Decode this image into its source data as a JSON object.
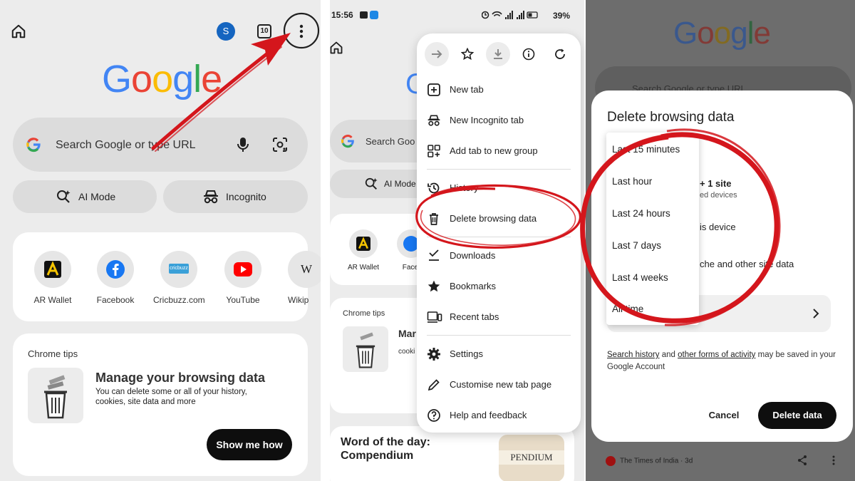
{
  "panel1": {
    "avatar_letter": "S",
    "tab_count": "10",
    "logo": [
      "G",
      "o",
      "o",
      "g",
      "l",
      "e"
    ],
    "search_placeholder": "Search Google or type URL",
    "ai_mode": "AI Mode",
    "incognito": "Incognito",
    "shortcuts": [
      {
        "label": "AR Wallet",
        "color": "#111111"
      },
      {
        "label": "Facebook",
        "color": "#1877f2"
      },
      {
        "label": "Cricbuzz.com",
        "color": "#3aa0d8"
      },
      {
        "label": "YouTube",
        "color": "#ff0000"
      },
      {
        "label": "Wikip"
      }
    ],
    "chrome_tips": "Chrome tips",
    "tip_title": "Manage your browsing data",
    "tip_body": "You can delete some or all of your history, cookies, site data and more",
    "tip_button": "Show me how"
  },
  "panel2": {
    "status_time": "15:56",
    "status_battery": "39%",
    "search_partial": "Search Goo",
    "ai_partial": "AI Mode",
    "shortcut1": "AR Wallet",
    "shortcut2": "Facel",
    "chrome_tips": "Chrome tips",
    "tip_partial_title": "Mar",
    "tip_partial_body": "cooki",
    "word_day": "Word of the day:",
    "word": "Compendium",
    "thumb_text": "PENDIUM",
    "menu": {
      "items": [
        {
          "label": "New tab",
          "icon": "plus-box-icon"
        },
        {
          "label": "New Incognito tab",
          "icon": "incognito-icon"
        },
        {
          "label": "Add tab to new group",
          "icon": "group-icon"
        },
        {
          "label": "History",
          "icon": "history-icon"
        },
        {
          "label": "Delete browsing data",
          "icon": "trash-icon"
        },
        {
          "label": "Downloads",
          "icon": "download-check-icon"
        },
        {
          "label": "Bookmarks",
          "icon": "star-filled-icon"
        },
        {
          "label": "Recent tabs",
          "icon": "recent-tabs-icon"
        },
        {
          "label": "Settings",
          "icon": "gear-icon"
        },
        {
          "label": "Customise new tab page",
          "icon": "pencil-icon"
        },
        {
          "label": "Help and feedback",
          "icon": "help-icon"
        }
      ]
    }
  },
  "panel3": {
    "title": "Delete browsing data",
    "search_partial": "Search Google or type URL",
    "options": [
      "Last 15 minutes",
      "Last hour",
      "Last 24 hours",
      "Last 7 days",
      "Last 4 weeks",
      "All time"
    ],
    "behind_site": "+ 1 site",
    "behind_devices": "ed devices",
    "behind_device": "is device",
    "behind_cache": "che and other site data",
    "footer_link1": "Search history",
    "footer_and": "and",
    "footer_link2": "other forms of activity",
    "footer_rest": "may be saved in your Google Account",
    "cancel": "Cancel",
    "delete": "Delete data",
    "news_source": "The Times of India · 3d"
  },
  "colors": {
    "accent_red": "#d4161c",
    "google_blue": "#4285f4",
    "google_red": "#ea4335",
    "google_yellow": "#fbbc05",
    "google_green": "#34a853"
  }
}
